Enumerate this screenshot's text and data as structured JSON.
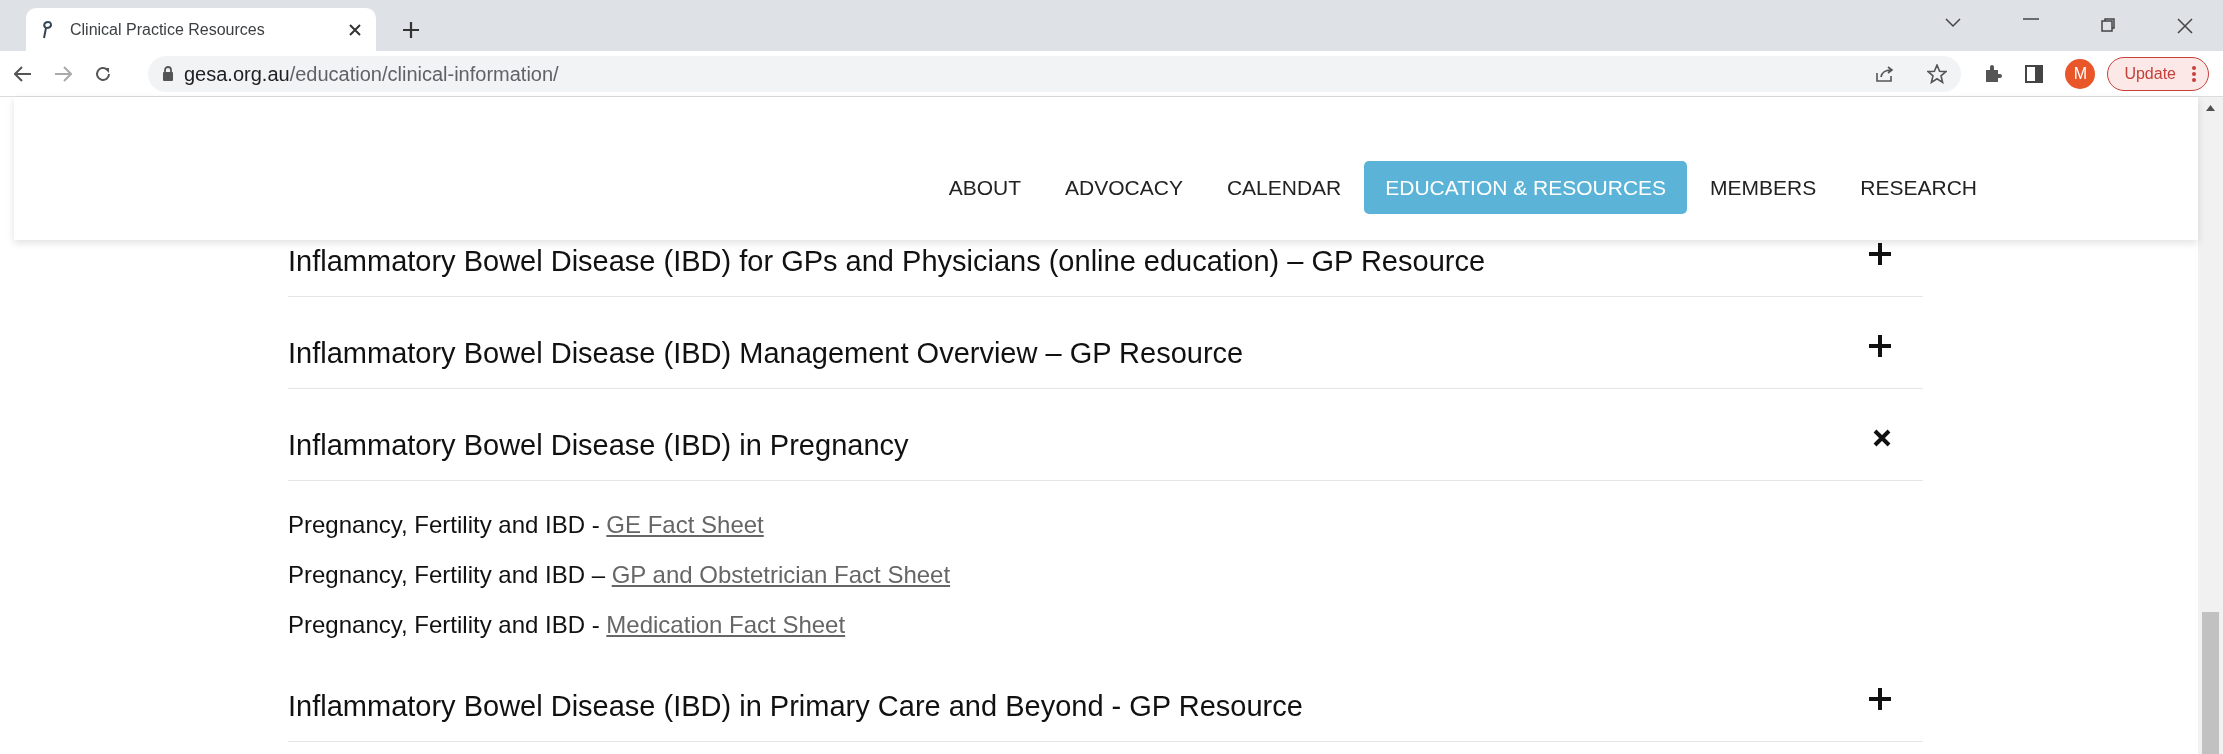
{
  "browser": {
    "tab_title": "Clinical Practice Resources",
    "url_domain": "gesa.org.au",
    "url_path": "/education/clinical-information/",
    "profile_initial": "M",
    "update_label": "Update"
  },
  "nav": [
    {
      "label": "ABOUT",
      "selected": false
    },
    {
      "label": "ADVOCACY",
      "selected": false
    },
    {
      "label": "CALENDAR",
      "selected": false
    },
    {
      "label": "EDUCATION & RESOURCES",
      "selected": true
    },
    {
      "label": "MEMBERS",
      "selected": false
    },
    {
      "label": "RESEARCH",
      "selected": false
    }
  ],
  "accordion": [
    {
      "title": "Inflammatory Bowel Disease (IBD) for GPs and Physicians (online education) – GP Resource",
      "expanded": false
    },
    {
      "title": "Inflammatory Bowel Disease (IBD) Management Overview – GP Resource",
      "expanded": false
    },
    {
      "title": "Inflammatory Bowel Disease (IBD) in Pregnancy",
      "expanded": true,
      "links": [
        {
          "prefix": "Pregnancy, Fertility and IBD -",
          "link": "GE Fact Sheet"
        },
        {
          "prefix": "Pregnancy, Fertility and IBD –",
          "link": "GP and Obstetrician Fact Sheet"
        },
        {
          "prefix": "Pregnancy, Fertility and IBD -",
          "link": "Medication Fact Sheet"
        }
      ]
    },
    {
      "title": "Inflammatory Bowel Disease (IBD) in Primary Care and Beyond - GP Resource",
      "expanded": false
    }
  ]
}
